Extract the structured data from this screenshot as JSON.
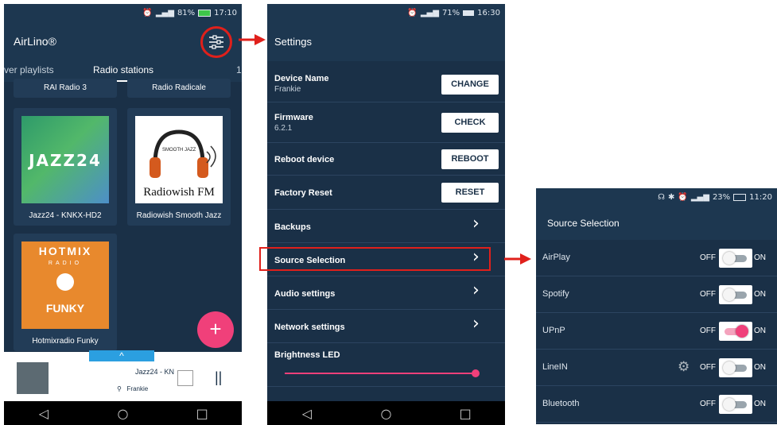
{
  "colors": {
    "accent": "#f0407a",
    "highlight": "#e0201b",
    "background": "#1a3047"
  },
  "phone1": {
    "status": {
      "battery": "81%",
      "time": "17:10"
    },
    "app_title": "AirLino®",
    "filter_icon": "sliders-icon",
    "tabs": [
      {
        "label": "ver playlists"
      },
      {
        "label": "Radio stations"
      },
      {
        "label": "1"
      }
    ],
    "stations_top": [
      {
        "name": "RAI Radio 3"
      },
      {
        "name": "Radio Radicale"
      }
    ],
    "stations": [
      {
        "name": "Jazz24 - KNKX-HD2",
        "cover": "JAZZ24"
      },
      {
        "name": "Radiowish Smooth Jazz",
        "cover": "Radiowish FM",
        "cover_small": "SMOOTH JAZZ"
      },
      {
        "name": "Hotmixradio Funky",
        "cover_top": "HOTMIX",
        "cover_sub": "RADIO",
        "cover_bottom": "FUNKY"
      }
    ],
    "fab": "+",
    "player": {
      "handle": "^",
      "title": "Jazz24 - KN",
      "device": "Frankie",
      "pause": "||"
    },
    "nav": {
      "back": "◁",
      "home": "○",
      "recent": "□"
    }
  },
  "phone2": {
    "status": {
      "battery": "71%",
      "time": "16:30"
    },
    "title": "Settings",
    "rows": [
      {
        "label": "Device Name",
        "sub": "Frankie",
        "button": "CHANGE"
      },
      {
        "label": "Firmware",
        "sub": "6.2.1",
        "button": "CHECK"
      },
      {
        "label": "Reboot device",
        "button": "REBOOT"
      },
      {
        "label": "Factory Reset",
        "button": "RESET"
      },
      {
        "label": "Backups",
        "chevron": "›"
      },
      {
        "label": "Source Selection",
        "chevron": "›"
      },
      {
        "label": "Audio settings",
        "chevron": "›"
      },
      {
        "label": "Network settings",
        "chevron": "›"
      },
      {
        "label": "Brightness LED"
      }
    ],
    "brightness": 1.0,
    "nav": {
      "back": "◁",
      "home": "○",
      "recent": "□"
    }
  },
  "phone3": {
    "status": {
      "battery": "23%",
      "time": "11:20"
    },
    "title": "Source Selection",
    "off_label": "OFF",
    "on_label": "ON",
    "sources": [
      {
        "label": "AirPlay",
        "on": false
      },
      {
        "label": "Spotify",
        "on": false
      },
      {
        "label": "UPnP",
        "on": true
      },
      {
        "label": "LineIN",
        "on": false,
        "gear": true
      },
      {
        "label": "Bluetooth",
        "on": false
      }
    ]
  }
}
